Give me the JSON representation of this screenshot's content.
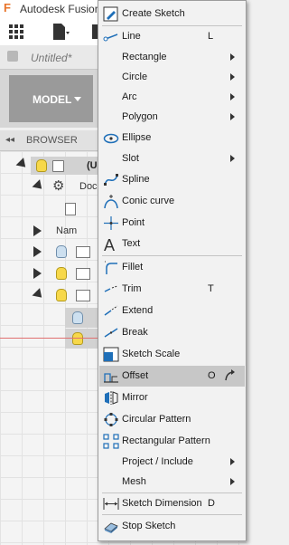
{
  "app": {
    "title": "Autodesk Fusion",
    "doc_title": "Untitled*",
    "workspace": "MODEL",
    "browser_label": "BROWSER",
    "tree": {
      "root_label": "(Un",
      "doc_settings": "Doc",
      "named_views": "Nam"
    }
  },
  "menu": {
    "items": [
      {
        "label": "Create Sketch",
        "shortcut": "",
        "submenu": false,
        "icon": "create-sketch-icon"
      },
      {
        "label": "Line",
        "shortcut": "L",
        "submenu": false,
        "icon": "line-icon"
      },
      {
        "label": "Rectangle",
        "shortcut": "",
        "submenu": true
      },
      {
        "label": "Circle",
        "shortcut": "",
        "submenu": true
      },
      {
        "label": "Arc",
        "shortcut": "",
        "submenu": true
      },
      {
        "label": "Polygon",
        "shortcut": "",
        "submenu": true
      },
      {
        "label": "Ellipse",
        "shortcut": "",
        "submenu": false,
        "icon": "ellipse-icon"
      },
      {
        "label": "Slot",
        "shortcut": "",
        "submenu": true
      },
      {
        "label": "Spline",
        "shortcut": "",
        "submenu": false,
        "icon": "spline-icon"
      },
      {
        "label": "Conic curve",
        "shortcut": "",
        "submenu": false,
        "icon": "conic-curve-icon"
      },
      {
        "label": "Point",
        "shortcut": "",
        "submenu": false,
        "icon": "point-icon"
      },
      {
        "label": "Text",
        "shortcut": "",
        "submenu": false,
        "icon": "text-icon"
      },
      {
        "label": "Fillet",
        "shortcut": "",
        "submenu": false,
        "icon": "fillet-icon"
      },
      {
        "label": "Trim",
        "shortcut": "T",
        "submenu": false,
        "icon": "trim-icon"
      },
      {
        "label": "Extend",
        "shortcut": "",
        "submenu": false,
        "icon": "extend-icon"
      },
      {
        "label": "Break",
        "shortcut": "",
        "submenu": false,
        "icon": "break-icon"
      },
      {
        "label": "Sketch Scale",
        "shortcut": "",
        "submenu": false,
        "icon": "sketch-scale-icon"
      },
      {
        "label": "Offset",
        "shortcut": "O",
        "submenu": false,
        "icon": "offset-icon",
        "highlighted": true
      },
      {
        "label": "Mirror",
        "shortcut": "",
        "submenu": false,
        "icon": "mirror-icon"
      },
      {
        "label": "Circular Pattern",
        "shortcut": "",
        "submenu": false,
        "icon": "circular-pattern-icon"
      },
      {
        "label": "Rectangular Pattern",
        "shortcut": "",
        "submenu": false,
        "icon": "rectangular-pattern-icon"
      },
      {
        "label": "Project / Include",
        "shortcut": "",
        "submenu": true
      },
      {
        "label": "Mesh",
        "shortcut": "",
        "submenu": true
      },
      {
        "label": "Sketch Dimension",
        "shortcut": "D",
        "submenu": false,
        "icon": "sketch-dimension-icon"
      },
      {
        "label": "Stop Sketch",
        "shortcut": "",
        "submenu": false,
        "icon": "stop-sketch-icon"
      }
    ]
  },
  "colors": {
    "icon_blue": "#1f6fb8",
    "highlight": "#c7c7c7",
    "menu_bg": "#f2f2f2"
  }
}
